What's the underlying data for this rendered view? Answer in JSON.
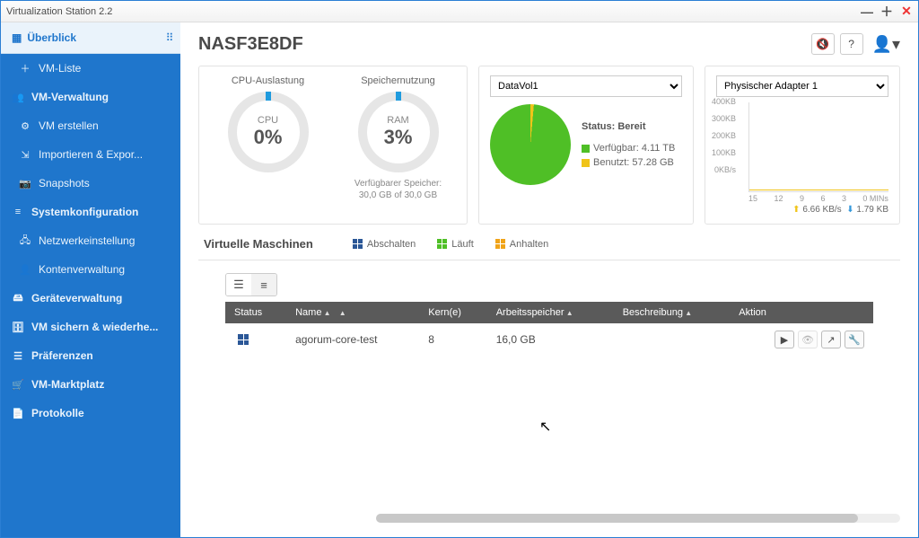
{
  "window_title": "Virtualization Station 2.2",
  "sidebar": {
    "overview": "Überblick",
    "items": [
      {
        "label": "VM-Liste",
        "icon": "plus-icon"
      },
      {
        "label": "VM-Verwaltung",
        "icon": "users-icon",
        "bold": true
      },
      {
        "label": "VM erstellen",
        "icon": "gear-icon"
      },
      {
        "label": "Importieren & Expor...",
        "icon": "import-icon"
      },
      {
        "label": "Snapshots",
        "icon": "camera-icon"
      },
      {
        "label": "Systemkonfiguration",
        "icon": "sliders-icon",
        "bold": true
      },
      {
        "label": "Netzwerkeinstellung",
        "icon": "network-icon"
      },
      {
        "label": "Kontenverwaltung",
        "icon": "user-icon"
      },
      {
        "label": "Geräteverwaltung",
        "icon": "device-icon",
        "bold": true
      },
      {
        "label": "VM sichern & wiederhe...",
        "icon": "backup-icon",
        "bold": true
      },
      {
        "label": "Präferenzen",
        "icon": "pref-icon",
        "bold": true
      },
      {
        "label": "VM-Marktplatz",
        "icon": "market-icon",
        "bold": true
      },
      {
        "label": "Protokolle",
        "icon": "log-icon",
        "bold": true
      }
    ]
  },
  "header": {
    "title": "NASF3E8DF"
  },
  "gauges": {
    "cpu_title": "CPU-Auslastung",
    "cpu_label": "CPU",
    "cpu_value": "0%",
    "ram_title": "Speichernutzung",
    "ram_label": "RAM",
    "ram_value": "3%",
    "ram_sub1": "Verfügbarer Speicher:",
    "ram_sub2": "30,0 GB of 30,0 GB"
  },
  "storage": {
    "volume": "DataVol1",
    "status_label": "Status: Bereit",
    "available_label": "Verfügbar: 4.11 TB",
    "used_label": "Benutzt: 57.28 GB"
  },
  "network": {
    "adapter": "Physischer Adapter 1",
    "yticks": [
      "400KB",
      "300KB",
      "200KB",
      "100KB",
      "0KB/s"
    ],
    "xticks": [
      "15",
      "12",
      "9",
      "6",
      "3",
      "0 MINs"
    ],
    "up": "6.66 KB/s",
    "down": "1.79 KB"
  },
  "vmbar": {
    "title": "Virtuelle Maschinen",
    "off": "Abschalten",
    "running": "Läuft",
    "paused": "Anhalten"
  },
  "table": {
    "headers": {
      "status": "Status",
      "name": "Name",
      "cores": "Kern(e)",
      "memory": "Arbeitsspeicher",
      "desc": "Beschreibung",
      "action": "Aktion"
    },
    "rows": [
      {
        "name": "agorum-core-test",
        "cores": "8",
        "memory": "16,0 GB",
        "desc": ""
      }
    ]
  },
  "chart_data": {
    "type": "line",
    "title": "Physischer Adapter 1",
    "xlabel": "MINs",
    "ylabel": "KB/s",
    "x": [
      15,
      12,
      9,
      6,
      3,
      0
    ],
    "ylim": [
      0,
      400
    ],
    "series": [
      {
        "name": "Upload",
        "values": [
          0,
          0,
          0,
          0,
          0,
          0
        ],
        "color": "#f0c419"
      },
      {
        "name": "Download",
        "values": [
          0,
          0,
          0,
          0,
          0,
          0
        ],
        "color": "#3498db"
      }
    ],
    "current": {
      "up_kb_s": 6.66,
      "down_kb": 1.79
    }
  }
}
